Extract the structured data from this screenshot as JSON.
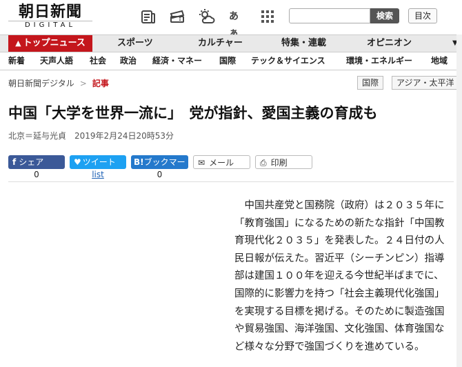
{
  "header": {
    "logo_main": "朝日新聞",
    "logo_sub": "DIGITAL",
    "icons": [
      "newspaper-icon",
      "ticket-icon",
      "weather-icon",
      "font-size-icon",
      "grid-menu-icon"
    ],
    "font_icon_label": "あぁ",
    "search_placeholder": "",
    "search_button": "検索",
    "index_button": "目次"
  },
  "main_nav": [
    {
      "label": "トップニュース",
      "active": true
    },
    {
      "label": "スポーツ"
    },
    {
      "label": "カルチャー"
    },
    {
      "label": "特集・連載"
    },
    {
      "label": "オピニオン"
    }
  ],
  "sub_nav": [
    "新着",
    "天声人語",
    "社会",
    "政治",
    "経済・マネー",
    "国際",
    "テック＆サイエンス",
    "環境・エネルギー",
    "地域"
  ],
  "breadcrumb": {
    "home": "朝日新聞デジタル",
    "separator": ">",
    "current": "記事"
  },
  "tags": [
    "国際",
    "アジア・太平洋"
  ],
  "article": {
    "title": "中国「大学を世界一流に」　党が指針、愛国主義の育成も",
    "author": "北京＝延与光貞",
    "date": "2019年2月24日20時53分",
    "body": "中国共産党と国務院（政府）は２０３５年に「教育強国」になるための新たな指針「中国教育現代化２０３５」を発表した。２４日付の人民日報が伝えた。習近平（シーチンピン）指導部は建国１００年を迎える今世紀半ばまでに、国際的に影響力を持つ「社会主義現代化強国」を実現する目標を掲げる。そのために製造強国や貿易強国、海洋強国、文化強国、体育強国など様々な分野で強国づくりを進めている。"
  },
  "share": {
    "facebook": {
      "label": "シェア",
      "count": "0"
    },
    "twitter": {
      "label": "ツイート",
      "count": "list"
    },
    "hatena": {
      "label": "ブックマー",
      "count": "0"
    },
    "mail": {
      "label": "メール"
    },
    "print": {
      "label": "印刷"
    }
  },
  "colors": {
    "brand_red": "#c4161c",
    "facebook": "#3b5998",
    "twitter": "#1da1f2",
    "hatena": "#2479cc"
  }
}
